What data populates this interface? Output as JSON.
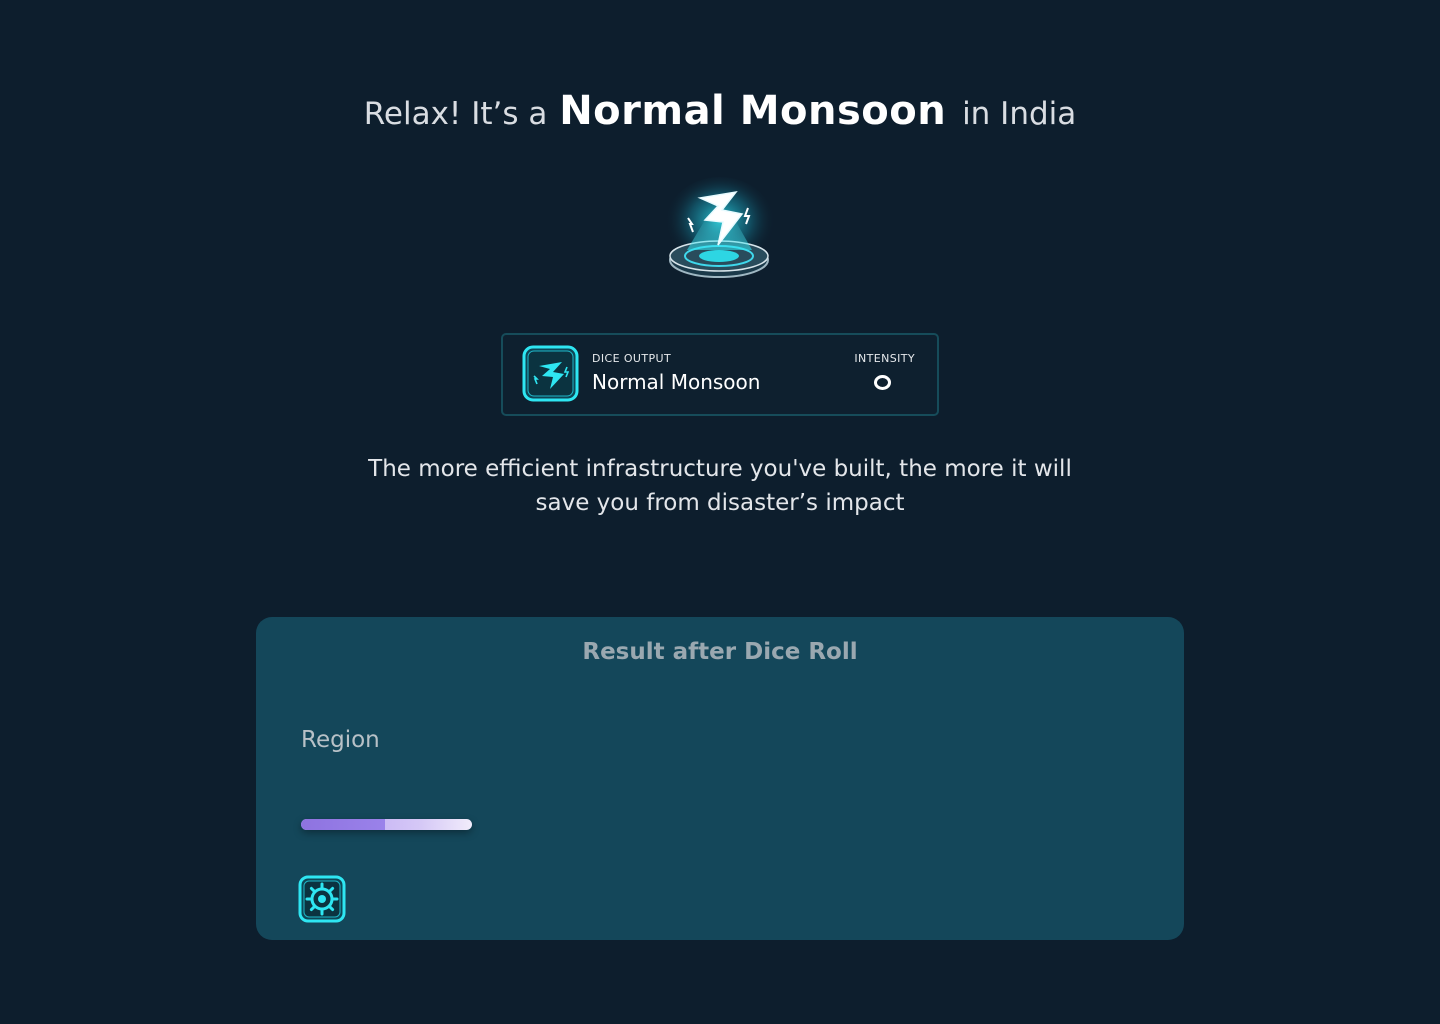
{
  "header": {
    "prefix": "Relax! It’s a",
    "emphasis": "Normal Monsoon",
    "suffix": "in India"
  },
  "hero": {
    "icon": "lightning-platform-icon"
  },
  "dice_card": {
    "icon": "lightning-icon",
    "output_label": "DICE OUTPUT",
    "output_value": "Normal Monsoon",
    "intensity_label": "INTENSITY",
    "intensity_icon": "intensity-ring-icon"
  },
  "description": {
    "line1": "The more efficient infrastructure you've built, the more it will",
    "line2": "save you from disaster’s impact"
  },
  "result": {
    "title": "Result after Dice Roll",
    "region_label": "Region",
    "progress_fraction": 0.49,
    "button_icon": "gear-icon"
  },
  "colors": {
    "background": "#0d1e2d",
    "panel": "#14475a",
    "accent_cyan": "#2ee6f2",
    "progress_purple": "#8e73e0"
  }
}
